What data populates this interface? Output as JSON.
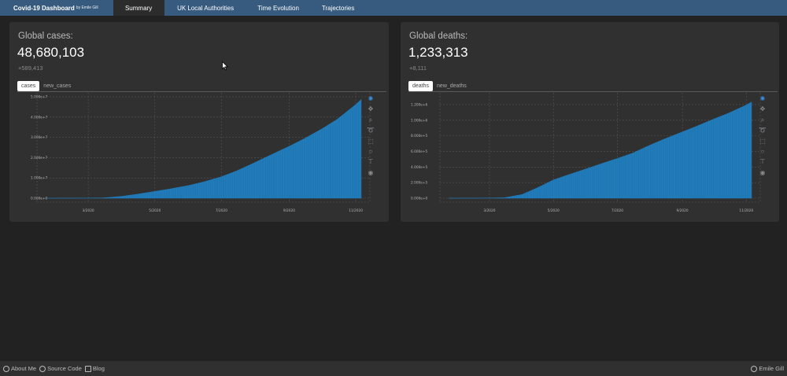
{
  "navbar": {
    "brand": "Covid-19 Dashboard",
    "brand_by": "by Emile Gill",
    "tabs": [
      {
        "label": "Summary",
        "active": true
      },
      {
        "label": "UK Local Authorities",
        "active": false
      },
      {
        "label": "Time Evolution",
        "active": false
      },
      {
        "label": "Trajectories",
        "active": false
      }
    ]
  },
  "cards": [
    {
      "title": "Global cases:",
      "value": "48,680,103",
      "delta": "+589,413",
      "pills": [
        {
          "label": "cases",
          "active": true
        },
        {
          "label": "new_cases",
          "active": false
        }
      ]
    },
    {
      "title": "Global deaths:",
      "value": "1,233,313",
      "delta": "+8,111",
      "pills": [
        {
          "label": "deaths",
          "active": true
        },
        {
          "label": "new_deaths",
          "active": false
        }
      ]
    }
  ],
  "chart_data": [
    {
      "type": "bar",
      "x_range": [
        "2020-01-22",
        "2020-11-06"
      ],
      "ylim": [
        0,
        50000000
      ],
      "y_ticks": [
        0,
        10000000,
        20000000,
        30000000,
        40000000,
        50000000
      ],
      "y_tick_labels": [
        "0.000e+0",
        "1.000e+7",
        "2.000e+7",
        "3.000e+7",
        "4.000e+7",
        "5.000e+7"
      ],
      "x_ticks": [
        "2020-03-01",
        "2020-05-01",
        "2020-07-01",
        "2020-09-01",
        "2020-11-01"
      ],
      "x_tick_labels": [
        "3/2020",
        "5/2020",
        "7/2020",
        "9/2020",
        "11/2020"
      ],
      "series": [
        {
          "color": "#1f77b4",
          "points": [
            [
              "2020-01-22",
              0
            ],
            [
              "2020-02-15",
              70000
            ],
            [
              "2020-03-01",
              90000
            ],
            [
              "2020-03-15",
              170000
            ],
            [
              "2020-04-01",
              950000
            ],
            [
              "2020-04-15",
              2000000
            ],
            [
              "2020-05-01",
              3400000
            ],
            [
              "2020-05-15",
              4600000
            ],
            [
              "2020-06-01",
              6300000
            ],
            [
              "2020-06-15",
              8100000
            ],
            [
              "2020-07-01",
              10600000
            ],
            [
              "2020-07-15",
              13500000
            ],
            [
              "2020-08-01",
              17700000
            ],
            [
              "2020-08-15",
              21300000
            ],
            [
              "2020-09-01",
              25600000
            ],
            [
              "2020-09-15",
              29400000
            ],
            [
              "2020-10-01",
              34200000
            ],
            [
              "2020-10-15",
              38900000
            ],
            [
              "2020-11-01",
              46200000
            ],
            [
              "2020-11-06",
              48680103
            ]
          ]
        }
      ],
      "grid": true
    },
    {
      "type": "bar",
      "x_range": [
        "2020-01-22",
        "2020-11-06"
      ],
      "ylim": [
        0,
        1300000
      ],
      "y_ticks": [
        0,
        200000,
        400000,
        600000,
        800000,
        1000000,
        1200000
      ],
      "y_tick_labels": [
        "0.000e+0",
        "2.000e+5",
        "4.000e+5",
        "6.000e+5",
        "8.000e+5",
        "1.000e+6",
        "1.200e+6"
      ],
      "x_ticks": [
        "2020-03-01",
        "2020-05-01",
        "2020-07-01",
        "2020-09-01",
        "2020-11-01"
      ],
      "x_tick_labels": [
        "3/2020",
        "5/2020",
        "7/2020",
        "9/2020",
        "11/2020"
      ],
      "series": [
        {
          "color": "#1f77b4",
          "points": [
            [
              "2020-01-22",
              0
            ],
            [
              "2020-02-15",
              1500
            ],
            [
              "2020-03-01",
              3000
            ],
            [
              "2020-03-15",
              6000
            ],
            [
              "2020-04-01",
              48000
            ],
            [
              "2020-04-15",
              130000
            ],
            [
              "2020-05-01",
              235000
            ],
            [
              "2020-05-15",
              300000
            ],
            [
              "2020-06-01",
              375000
            ],
            [
              "2020-06-15",
              440000
            ],
            [
              "2020-07-01",
              510000
            ],
            [
              "2020-07-15",
              575000
            ],
            [
              "2020-08-01",
              680000
            ],
            [
              "2020-08-15",
              760000
            ],
            [
              "2020-09-01",
              850000
            ],
            [
              "2020-09-15",
              925000
            ],
            [
              "2020-10-01",
              1015000
            ],
            [
              "2020-10-15",
              1090000
            ],
            [
              "2020-11-01",
              1195000
            ],
            [
              "2020-11-06",
              1233313
            ]
          ]
        }
      ],
      "grid": true
    }
  ],
  "footer": {
    "links": [
      {
        "label": "About Me",
        "icon": "user-circle-icon"
      },
      {
        "label": "Source Code",
        "icon": "github-icon"
      },
      {
        "label": "Blog",
        "icon": "medium-icon"
      }
    ],
    "right": {
      "label": "Emile Gill",
      "icon": "copyright-icon"
    }
  }
}
